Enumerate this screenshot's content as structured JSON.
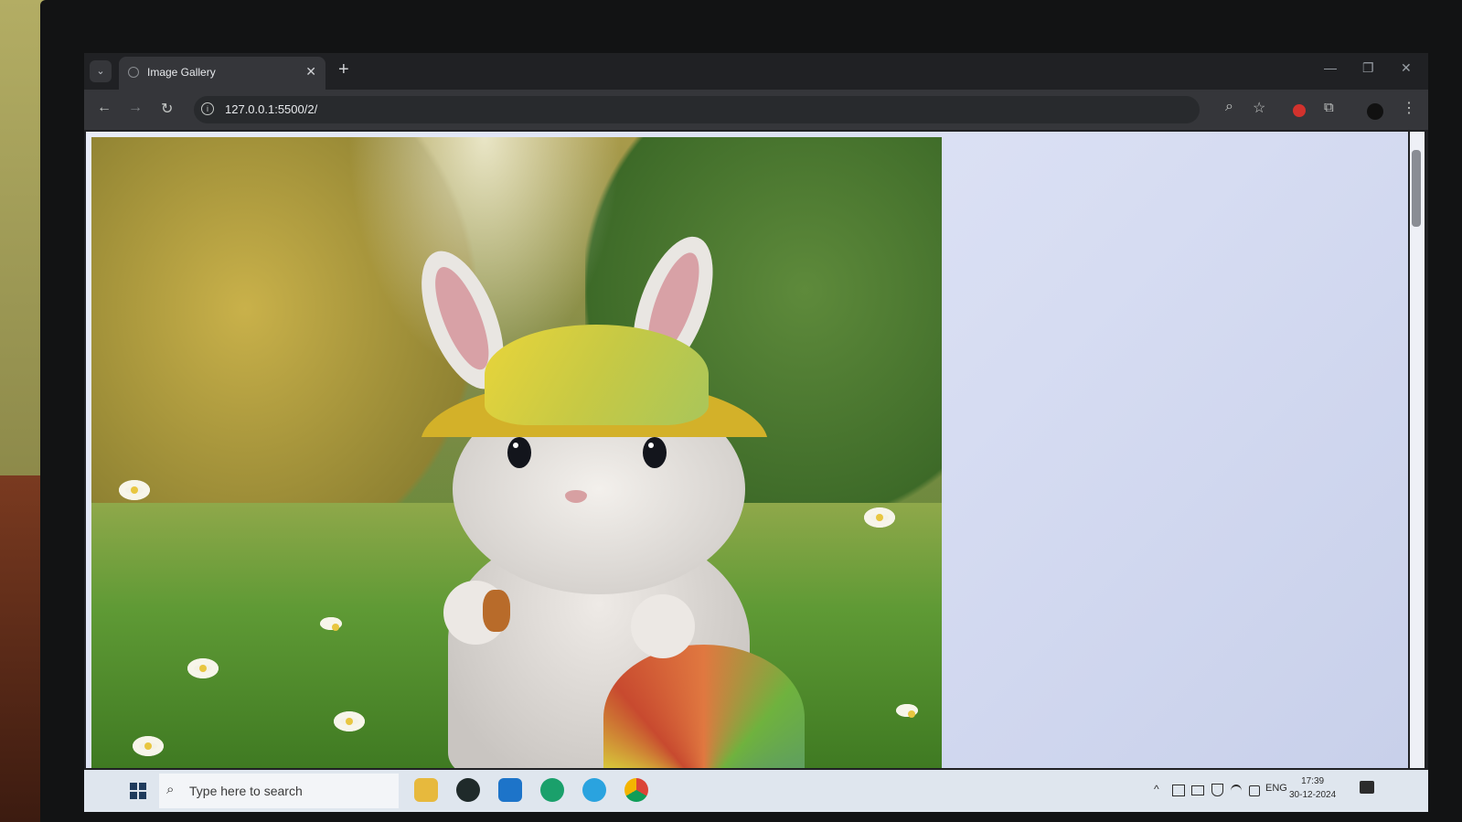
{
  "browser": {
    "tab_title": "Image Gallery",
    "tab_close": "✕",
    "new_tab": "+",
    "tab_search": "⌄",
    "window_minimize": "—",
    "window_restore": "❐",
    "window_close": "✕",
    "back": "←",
    "forward": "→",
    "reload": "↻",
    "site_info": "i",
    "url": "127.0.0.1:5500/2/",
    "zoom_icon": "⌕",
    "bookmark_icon": "☆",
    "extensions_icon": "⧉",
    "menu_icon": "⋮"
  },
  "page": {
    "image_alt": "Bunny in yellow hat"
  },
  "taskbar": {
    "search_icon": "⌕",
    "search_placeholder": "Type here to search",
    "tray_chevron": "^",
    "language": "ENG",
    "time": "17:39",
    "date": "30-12-2024"
  },
  "colors": {
    "tab_bg": "#35363a",
    "chrome_bg": "#202124",
    "page_bg": "#dfe3f3"
  }
}
